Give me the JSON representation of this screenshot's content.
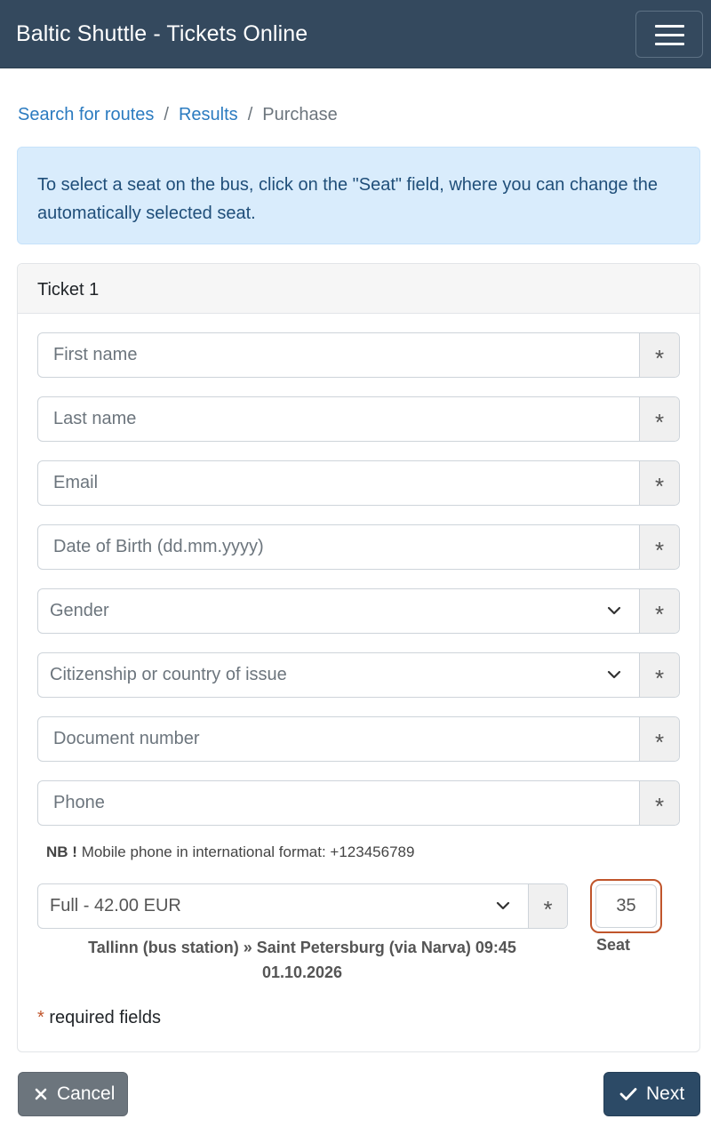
{
  "app": {
    "title": "Baltic Shuttle - Tickets Online",
    "menu_icon": "hamburger-icon"
  },
  "breadcrumb": {
    "items": [
      "Search for routes",
      "Results"
    ],
    "current": "Purchase",
    "separator": "/"
  },
  "alert": {
    "text": "To select a seat on the bus, click on the \"Seat\" field, where you can change the automatically selected seat."
  },
  "ticket": {
    "header": "Ticket 1",
    "fields": {
      "first_name": {
        "placeholder": "First name",
        "required": "*"
      },
      "last_name": {
        "placeholder": "Last name",
        "required": "*"
      },
      "email": {
        "placeholder": "Email",
        "required": "*"
      },
      "dob": {
        "placeholder": "Date of Birth (dd.mm.yyyy)",
        "required": "*"
      },
      "gender": {
        "selected": "Gender",
        "required": "*"
      },
      "citizenship": {
        "selected": "Citizenship or country of issue",
        "required": "*"
      },
      "document": {
        "placeholder": "Document number",
        "required": "*"
      },
      "phone": {
        "placeholder": "Phone",
        "required": "*"
      }
    },
    "phone_note": {
      "label": "NB !",
      "text": "Mobile phone in international format: +123456789"
    },
    "fare": {
      "selected": "Full - 42.00 EUR",
      "required": "*"
    },
    "route": {
      "line1": "Tallinn (bus station) » Saint Petersburg (via Narva) 09:45",
      "line2": "01.10.2026"
    },
    "seat": {
      "value": "35",
      "label": "Seat"
    },
    "required_note": {
      "star": "*",
      "text": " required fields"
    }
  },
  "buttons": {
    "cancel": "Cancel",
    "next": "Next"
  },
  "colors": {
    "navbar": "#34495e",
    "link": "#2b7bc0",
    "alert_bg": "#d9ecfc",
    "seat_highlight": "#c0552b",
    "cancel_bg": "#6c757d",
    "next_bg": "#2c4a66"
  }
}
